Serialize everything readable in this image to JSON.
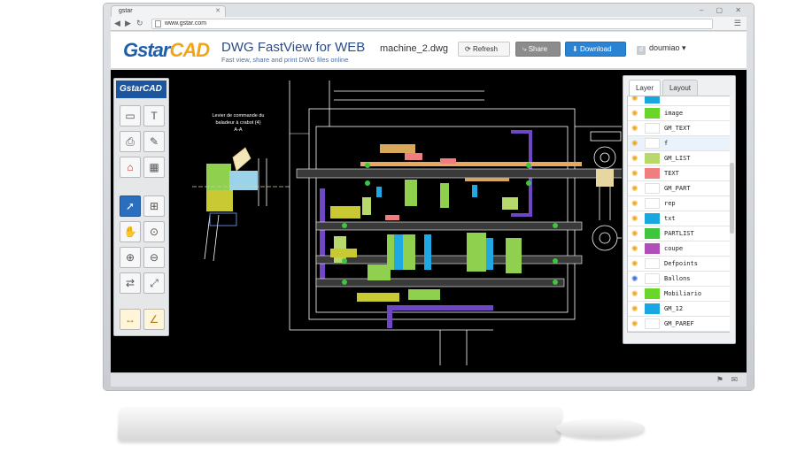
{
  "browser": {
    "tab_title": "gstar",
    "url": "www.gstar.com"
  },
  "header": {
    "logo_g": "Gstar",
    "logo_cad": "CAD",
    "app_title": "DWG FastView for WEB",
    "app_subtitle": "Fast view, share and print DWG files online",
    "file_name": "machine_2.dwg",
    "refresh_label": "Refresh",
    "share_label": "Share",
    "download_label": "Download",
    "user_initial": "d",
    "user_name": "doumiao"
  },
  "toolbar": {
    "logo": "GstarCAD",
    "buttons": [
      "open-folder",
      "text-size",
      "print",
      "edit",
      "pdf-export",
      "image-export",
      "select-arrow",
      "zoom-window",
      "pan-hand",
      "zoom-realtime",
      "zoom-in",
      "zoom-out",
      "regen",
      "fullscreen",
      "measure-distance",
      "measure-angle"
    ]
  },
  "drawing": {
    "caption_line1": "Levier de commande du",
    "caption_line2": "baladeur à crabot (4)",
    "caption_line3": "A-A"
  },
  "layer_panel": {
    "tabs": [
      "Layer",
      "Layout"
    ],
    "layers": [
      {
        "name": "",
        "color": "#19a7e0",
        "on": true
      },
      {
        "name": "image",
        "color": "#6bd62a",
        "on": true
      },
      {
        "name": "GM_TEXT",
        "color": "#ffffff",
        "on": true
      },
      {
        "name": "f",
        "color": "#ffffff",
        "on": true
      },
      {
        "name": "GM_LIST",
        "color": "#b7d96b",
        "on": true
      },
      {
        "name": "TEXT",
        "color": "#f07e7e",
        "on": true
      },
      {
        "name": "GM_PART",
        "color": "#ffffff",
        "on": true
      },
      {
        "name": "rep",
        "color": "#ffffff",
        "on": true
      },
      {
        "name": "txt",
        "color": "#19a7e0",
        "on": true
      },
      {
        "name": "PARTLIST",
        "color": "#3dc63d",
        "on": true
      },
      {
        "name": "coupe",
        "color": "#b14db8",
        "on": true
      },
      {
        "name": "Defpoints",
        "color": "#ffffff",
        "on": true
      },
      {
        "name": "Ballons",
        "color": "#ffffff",
        "on": false
      },
      {
        "name": "Mobiliario",
        "color": "#6bd62a",
        "on": true
      },
      {
        "name": "GM_12",
        "color": "#19a7e0",
        "on": true
      },
      {
        "name": "GM_PAREF",
        "color": "#ffffff",
        "on": true
      },
      {
        "name": "",
        "color": "#ffffff",
        "on": true
      }
    ]
  }
}
